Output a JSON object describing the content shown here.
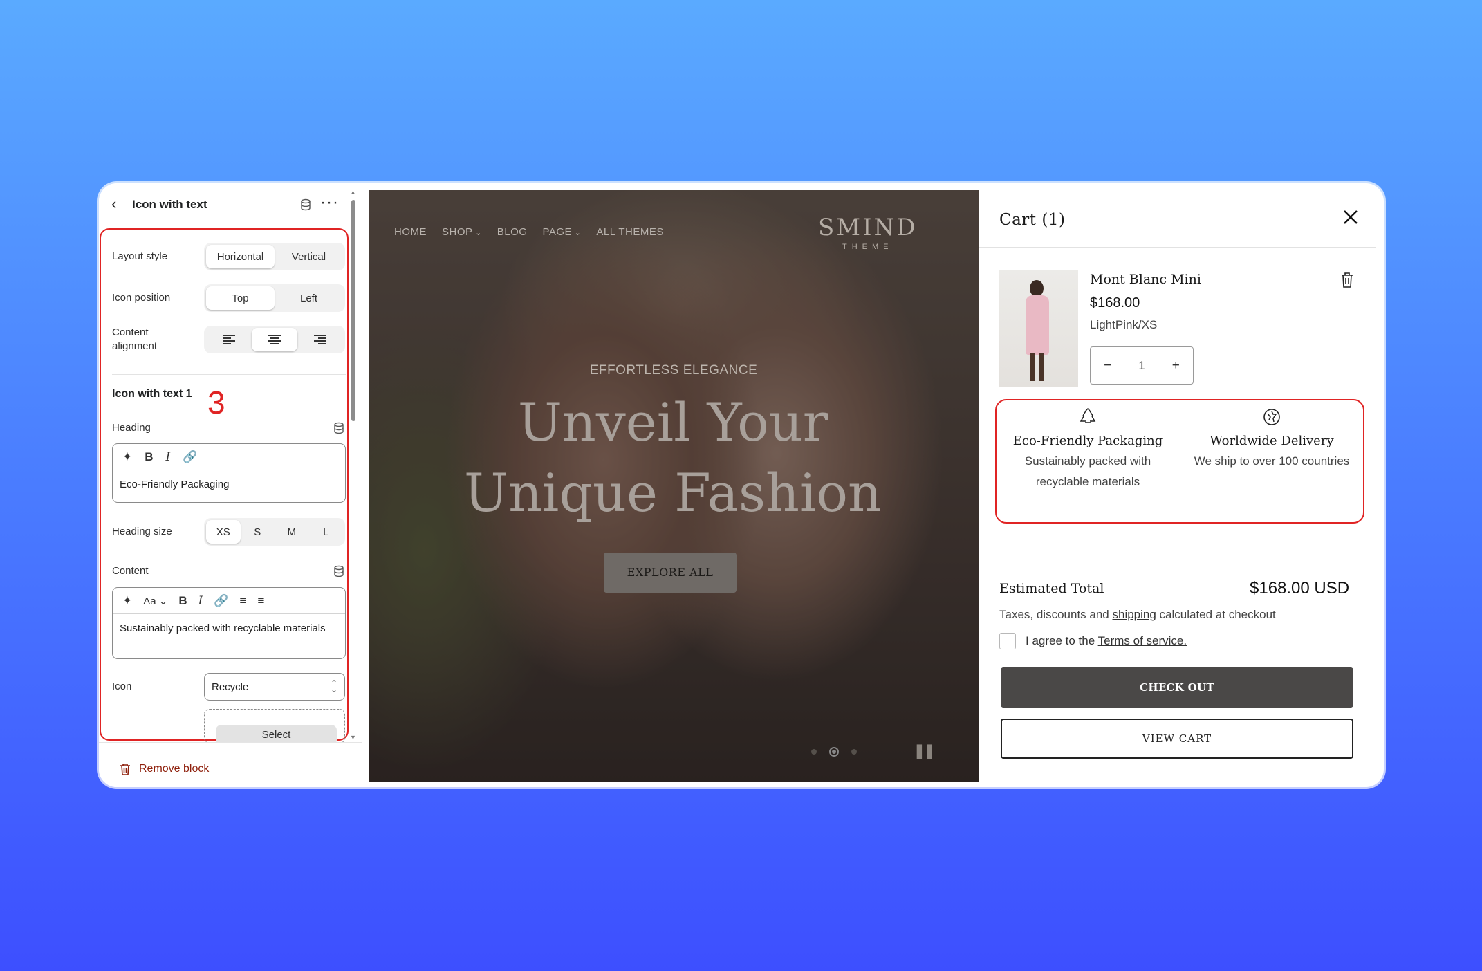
{
  "editor": {
    "title": "Icon with text",
    "layout_style": {
      "label": "Layout style",
      "options": [
        "Horizontal",
        "Vertical"
      ],
      "selected": "Horizontal"
    },
    "icon_position": {
      "label": "Icon position",
      "options": [
        "Top",
        "Left"
      ],
      "selected": "Top"
    },
    "content_alignment": {
      "label_line1": "Content",
      "label_line2": "alignment",
      "options": [
        "left-align-icon",
        "center-align-icon",
        "right-align-icon"
      ],
      "selected": "center-align-icon"
    },
    "block_title": "Icon with text 1",
    "step_number": "3",
    "heading": {
      "label": "Heading",
      "value": "Eco-Friendly Packaging"
    },
    "heading_size": {
      "label": "Heading size",
      "options": [
        "XS",
        "S",
        "M",
        "L"
      ],
      "selected": "XS"
    },
    "content": {
      "label": "Content",
      "font_menu": "Aa",
      "value": "Sustainably packed with recyclable materials"
    },
    "icon": {
      "label": "Icon",
      "value": "Recycle"
    },
    "image_picker": {
      "button": "Select"
    },
    "remove_block": "Remove block"
  },
  "preview": {
    "nav": [
      "HOME",
      "SHOP",
      "BLOG",
      "PAGE",
      "ALL THEMES"
    ],
    "brand": {
      "name": "SMIND",
      "sub": "THEME"
    },
    "tagline": "EFFORTLESS ELEGANCE",
    "hero_line1": "Unveil Your",
    "hero_line2": "Unique Fashion",
    "cta": "EXPLORE ALL",
    "slides": 3,
    "active_slide": 2
  },
  "cart": {
    "title": "Cart (1)",
    "product": {
      "name": "Mont Blanc Mini",
      "price": "$168.00",
      "variant": "LightPink/XS",
      "quantity": "1"
    },
    "trust": [
      {
        "icon": "recycle-icon",
        "heading": "Eco-Friendly Packaging",
        "desc_line1": "Sustainably packed with",
        "desc_line2": "recyclable materials"
      },
      {
        "icon": "globe-icon",
        "heading": "Worldwide Delivery",
        "desc_line1": "We ship to over 100 countries",
        "desc_line2": ""
      }
    ],
    "estimated_label": "Estimated Total",
    "estimated_value": "$168.00 USD",
    "tax_pre": "Taxes, discounts and ",
    "tax_link": "shipping",
    "tax_post": " calculated at checkout",
    "agree_pre": "I agree to the ",
    "agree_link": "Terms of service.",
    "checkout": "CHECK OUT",
    "view_cart": "VIEW CART"
  },
  "colors": {
    "accent_red": "#e02424",
    "checkout_bg": "#4a4847",
    "remove_red": "#8e1f0b"
  }
}
